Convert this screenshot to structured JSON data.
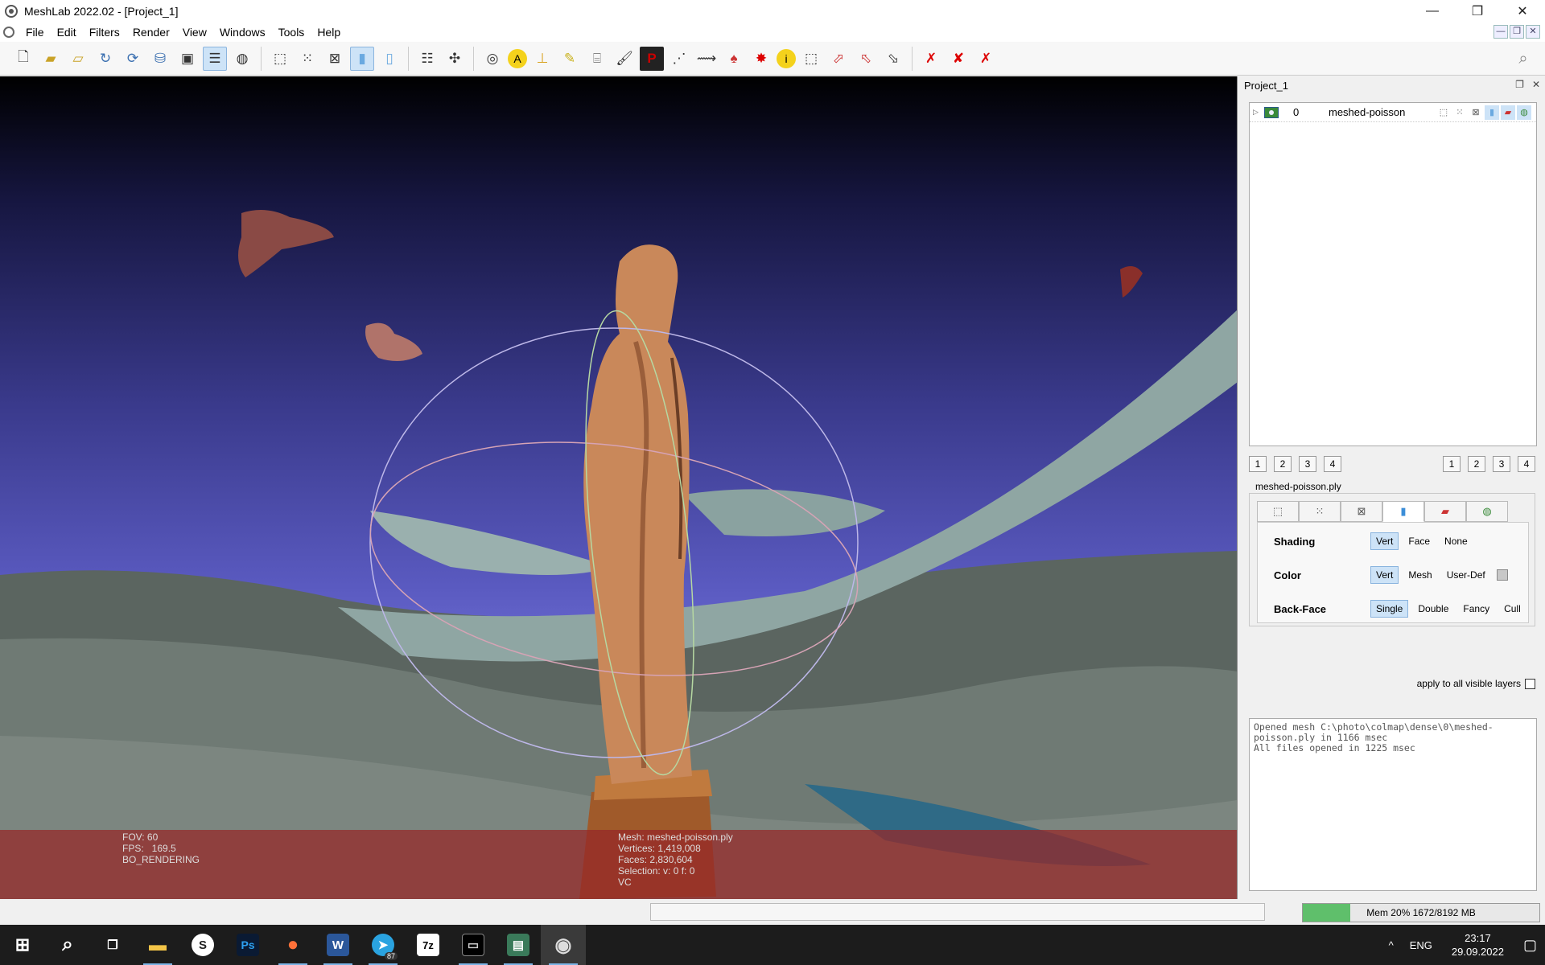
{
  "window": {
    "title": "MeshLab 2022.02 - [Project_1]",
    "controls": [
      "—",
      "❐",
      "✕"
    ]
  },
  "menu": {
    "items": [
      "File",
      "Edit",
      "Filters",
      "Render",
      "View",
      "Windows",
      "Tools",
      "Help"
    ],
    "mdi_controls": [
      "—",
      "❐",
      "✕"
    ]
  },
  "toolbar": {
    "groups": [
      [
        "new-project-icon",
        "open-project-icon",
        "import-mesh-icon",
        "reload-icon",
        "reload-all-icon",
        "export-mesh-icon",
        "snapshot-icon",
        "layers-icon",
        "raster-icon"
      ],
      [
        "bbox-icon",
        "points-icon",
        "wireframe-icon",
        "flat-icon",
        "smooth-icon"
      ],
      [
        "lighting-icon",
        "trackball-icon"
      ],
      [
        "sphere-icon",
        "annotate-icon",
        "axis-icon",
        "paint-select-icon",
        "camera-icon",
        "brush-icon",
        "pickpoints-icon",
        "align-icon",
        "measure-icon",
        "colorize-icon",
        "georef-icon",
        "info-icon",
        "select-faces-icon",
        "select-vertices-icon",
        "select-connected-icon",
        "select-area-icon"
      ],
      [
        "delete-faces-icon",
        "delete-vertices-icon",
        "delete-all-icon"
      ]
    ]
  },
  "viewport": {
    "info_left": [
      "FOV: 60",
      "FPS:   169.5",
      "BO_RENDERING"
    ],
    "info_right": [
      "Mesh: meshed-poisson.ply",
      "Vertices: 1,419,008",
      "Faces: 2,830,604",
      "Selection: v: 0 f: 0",
      "VC"
    ]
  },
  "panel": {
    "title": "Project_1",
    "header_controls": [
      "❐",
      "✕"
    ],
    "layers": [
      {
        "id": "0",
        "name": "meshed-poisson"
      }
    ],
    "left_numbers": [
      "1",
      "2",
      "3",
      "4"
    ],
    "right_numbers": [
      "1",
      "2",
      "3",
      "4"
    ],
    "mesh_file": "meshed-poisson.ply",
    "render_tabs": [
      "bbox-tab-icon",
      "points-tab-icon",
      "wire-tab-icon",
      "fill-tab-icon",
      "texture-tab-icon",
      "color-tab-icon"
    ],
    "shading": {
      "label": "Shading",
      "options": [
        "Vert",
        "Face",
        "None"
      ],
      "selected": "Vert"
    },
    "color": {
      "label": "Color",
      "options": [
        "Vert",
        "Mesh",
        "User-Def"
      ],
      "selected": "Vert",
      "user_color": "#c8c8c8"
    },
    "backface": {
      "label": "Back-Face",
      "options": [
        "Single",
        "Double",
        "Fancy",
        "Cull"
      ],
      "selected": "Single"
    },
    "apply_all": "apply to all visible layers",
    "log": [
      "Opened mesh C:\\photo\\colmap\\dense\\0\\meshed-",
      "poisson.ply in 1166 msec",
      "All files opened in 1225 msec"
    ]
  },
  "status": {
    "memory_text": "Mem 20% 1672/8192 MB",
    "memory_fraction": 0.2
  },
  "taskbar": {
    "apps": [
      {
        "name": "start",
        "glyph": "⊞"
      },
      {
        "name": "search",
        "glyph": "⌕"
      },
      {
        "name": "task-view",
        "glyph": "❐"
      },
      {
        "name": "file-explorer",
        "glyph": "▬"
      },
      {
        "name": "s-app",
        "glyph": "S"
      },
      {
        "name": "photoshop",
        "glyph": "Ps"
      },
      {
        "name": "firefox",
        "glyph": "●"
      },
      {
        "name": "word",
        "glyph": "W"
      },
      {
        "name": "telegram",
        "glyph": "➤",
        "badge": "87"
      },
      {
        "name": "7zip",
        "glyph": "7z"
      },
      {
        "name": "terminal",
        "glyph": "▭"
      },
      {
        "name": "image-viewer",
        "glyph": "▤"
      },
      {
        "name": "meshlab",
        "glyph": "◉"
      }
    ],
    "tray_arrow": "^",
    "lang": "ENG",
    "time": "23:17",
    "date": "29.09.2022",
    "notifications": "▢"
  }
}
